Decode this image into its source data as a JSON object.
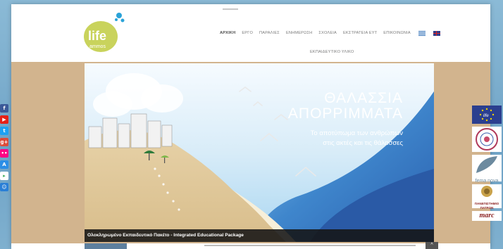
{
  "logo": {
    "word_top": "life",
    "word_bottom": "ammos"
  },
  "nav": {
    "items": [
      {
        "label": "ΑΡΧΙΚΗ",
        "active": true
      },
      {
        "label": "ΕΡΓΟ",
        "active": false
      },
      {
        "label": "ΠΑΡΑΛΙΕΣ",
        "active": false
      },
      {
        "label": "ΕΝΗΜΕΡΩΣΗ",
        "active": false
      },
      {
        "label": "ΣΧΟΛΕΙΑ",
        "active": false
      },
      {
        "label": "ΕΚΣΤΡΑΤΕΙΑ ΕΥΤ",
        "active": false
      },
      {
        "label": "ΕΠΙΚΟΙΝΩΝΙΑ",
        "active": false
      }
    ],
    "second_row": "ΕΚΠΑΙΔΕΥΤΙΚΟ ΥΛΙΚΟ"
  },
  "slide": {
    "title_line1": "ΘΑΛΑΣΣΙΑ",
    "title_line2": "ΑΠΟΡΡΙΜΜΑΤΑ",
    "subtitle_line1": "Το αποτύπωμα των ανθρώπων",
    "subtitle_line2": "στις ακτές και τις θάλασσες",
    "caption": "Ολοκληρωμένο Εκπαιδευτικό Πακέτο - Integrated Educational Package"
  },
  "social": [
    {
      "name": "facebook-icon",
      "glyph": "f",
      "color": "#3b5998"
    },
    {
      "name": "youtube-icon",
      "glyph": "▶",
      "color": "#e62117"
    },
    {
      "name": "twitter-icon",
      "glyph": "t",
      "color": "#1da1f2"
    },
    {
      "name": "google-plus-icon",
      "glyph": "g+",
      "color": "#dd4b39"
    },
    {
      "name": "flickr-icon",
      "glyph": "••",
      "color": "#ff0084"
    },
    {
      "name": "app-store-icon",
      "glyph": "A",
      "color": "#2b8ee6"
    },
    {
      "name": "google-play-icon",
      "glyph": "▸",
      "color": "#ffffff"
    },
    {
      "name": "contacts-icon",
      "glyph": "☺",
      "color": "#2a7fd6"
    }
  ],
  "partners": {
    "fema_text": "fema nova",
    "patras_text": "ΠΑΝΕΠΙΣΤΗΜΙΟ ΠΑΤΡΩΝ",
    "marc_text": "marc"
  },
  "colors": {
    "band": "#d2b48e",
    "sea": "#2f6fb7",
    "caption_bg": "#141414"
  }
}
